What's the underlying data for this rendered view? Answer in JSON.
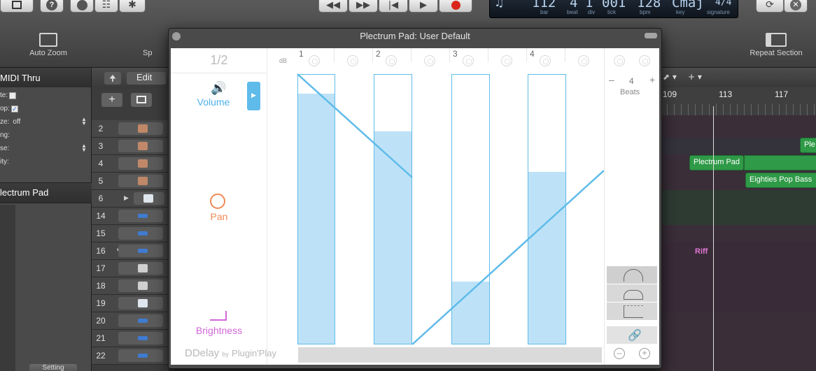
{
  "toolbar": {
    "lcd": {
      "bar": "112",
      "beat": "4",
      "div": "1",
      "tick": "001",
      "bpm": "128",
      "key": "Cmaj",
      "signature": "4/4",
      "bar_label": "bar",
      "beat_label": "beat",
      "div_label": "div",
      "tick_label": "tick",
      "bpm_label": "bpm",
      "key_label": "key",
      "signature_label": "signature"
    },
    "auto_zoom": "Auto Zoom",
    "repeat_section": "Repeat Section",
    "partial_label": "Sp"
  },
  "inspector": {
    "header": "MIDI Thru",
    "rows": [
      {
        "label": "te:",
        "kind": "checkbox",
        "checked": false
      },
      {
        "label": "op:",
        "kind": "checkbox",
        "checked": true
      },
      {
        "label": "ze:",
        "value": "off",
        "kind": "select"
      },
      {
        "label": "ng:"
      },
      {
        "label": "se:",
        "kind": "select"
      },
      {
        "label": "ity:"
      }
    ],
    "region_name": "lectrum Pad",
    "setting": "Setting"
  },
  "tracks": {
    "edit": "Edit",
    "rows": [
      {
        "num": "2",
        "icon": "keyboard-icon"
      },
      {
        "num": "3",
        "icon": "keyboard-icon"
      },
      {
        "num": "4",
        "icon": "keyboard-icon"
      },
      {
        "num": "5",
        "icon": "keyboard-icon"
      },
      {
        "num": "6",
        "icon": "folder-icon"
      },
      {
        "num": "14",
        "icon": "audio-icon"
      },
      {
        "num": "15",
        "icon": "audio-icon"
      },
      {
        "num": "16",
        "icon": "audio-icon"
      },
      {
        "num": "17",
        "icon": "drum-icon"
      },
      {
        "num": "18",
        "icon": "drum-icon"
      },
      {
        "num": "19",
        "icon": "folder-icon"
      },
      {
        "num": "20",
        "icon": "audio-icon"
      },
      {
        "num": "21",
        "icon": "audio-icon"
      },
      {
        "num": "22",
        "icon": "audio-icon"
      }
    ]
  },
  "arrange": {
    "ruler": [
      "109",
      "113",
      "117"
    ],
    "regions": {
      "plectrum_pad": "Plectrum Pad",
      "partial_top": "Ple",
      "eighties": "Eighties Pop Bass",
      "riff": "Riff"
    }
  },
  "plugin": {
    "title": "Plectrum Pad: User Default",
    "page": "1/2",
    "db_label": "dB",
    "params": {
      "volume": "Volume",
      "pan": "Pan",
      "brightness": "Brightness"
    },
    "beat_numbers": [
      "1",
      "2",
      "3",
      "4"
    ],
    "beats_value": "4",
    "beats_label": "Beats",
    "brand": {
      "name": "DDelay",
      "by": "by",
      "maker": "Plugin'Play"
    },
    "colors": {
      "accent": "#5fbbe9",
      "fill": "#bde2f7",
      "pan": "#f08a55",
      "brightness": "#d266d8",
      "volume": "#4fb0e8"
    },
    "bar_levels": [
      0.93,
      0.79,
      0.23,
      0.64
    ]
  }
}
